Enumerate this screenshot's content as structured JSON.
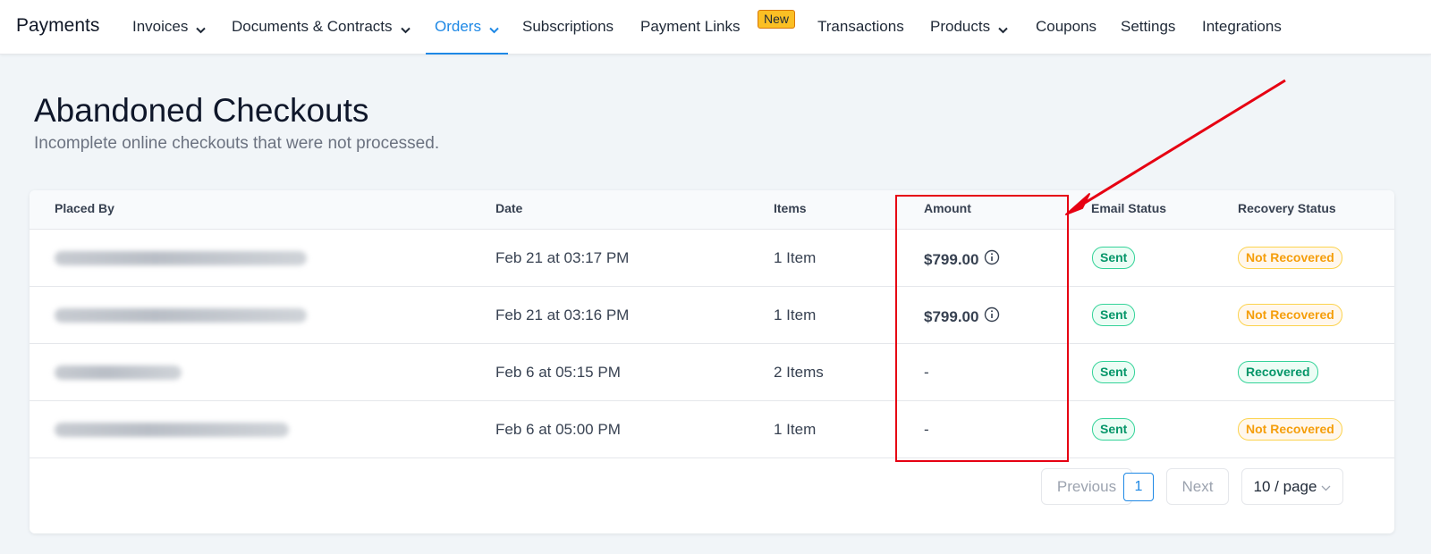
{
  "nav": {
    "brand": "Payments",
    "items": [
      {
        "label": "Invoices"
      },
      {
        "label": "Documents & Contracts"
      },
      {
        "label": "Orders"
      },
      {
        "label": "Subscriptions"
      },
      {
        "label": "Payment Links"
      },
      {
        "label": "Transactions"
      },
      {
        "label": "Products"
      },
      {
        "label": "Coupons"
      },
      {
        "label": "Settings"
      },
      {
        "label": "Integrations"
      }
    ],
    "active": "Orders",
    "new_badge": "New",
    "accent_color": "#1e88e5"
  },
  "page": {
    "title": "Abandoned Checkouts",
    "subtitle": "Incomplete online checkouts that were not processed."
  },
  "table": {
    "columns": [
      "Placed By",
      "Date",
      "Items",
      "Amount",
      "Email Status",
      "Recovery Status"
    ],
    "rows": [
      {
        "placed_by": "",
        "date": "Feb 21 at 03:17 PM",
        "items": "1 Item",
        "amount": "$799.00",
        "email_status": "Sent",
        "recovery_status": "Not Recovered"
      },
      {
        "placed_by": "",
        "date": "Feb 21 at 03:16 PM",
        "items": "1 Item",
        "amount": "$799.00",
        "email_status": "Sent",
        "recovery_status": "Not Recovered"
      },
      {
        "placed_by": "",
        "date": "Feb 6 at 05:15 PM",
        "items": "2 Items",
        "amount": "-",
        "email_status": "Sent",
        "recovery_status": "Recovered"
      },
      {
        "placed_by": "",
        "date": "Feb 6 at 05:00 PM",
        "items": "1 Item",
        "amount": "-",
        "email_status": "Sent",
        "recovery_status": "Not Recovered"
      }
    ]
  },
  "pagination": {
    "previous": "Previous",
    "current_page": "1",
    "next": "Next",
    "page_size": "10 / page"
  },
  "annotation": {
    "color": "#e60012"
  }
}
